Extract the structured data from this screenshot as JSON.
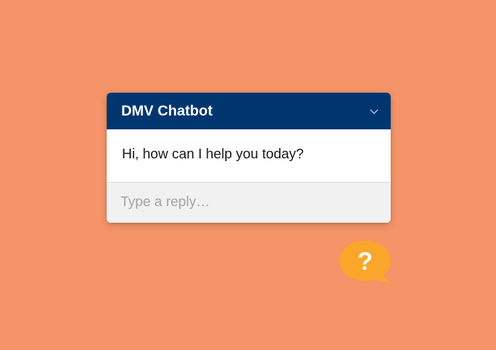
{
  "chatbot": {
    "title": "DMV Chatbot",
    "collapse_icon": "chevron-down-icon",
    "messages": [
      {
        "sender": "bot",
        "text": "Hi, how can I help you today?"
      }
    ],
    "reply": {
      "placeholder": "Type a reply…",
      "value": ""
    }
  },
  "help_button": {
    "icon": "question-mark-icon",
    "glyph": "?"
  },
  "colors": {
    "background": "#F49468",
    "header": "#003670",
    "help_bubble": "#F9A62B"
  }
}
